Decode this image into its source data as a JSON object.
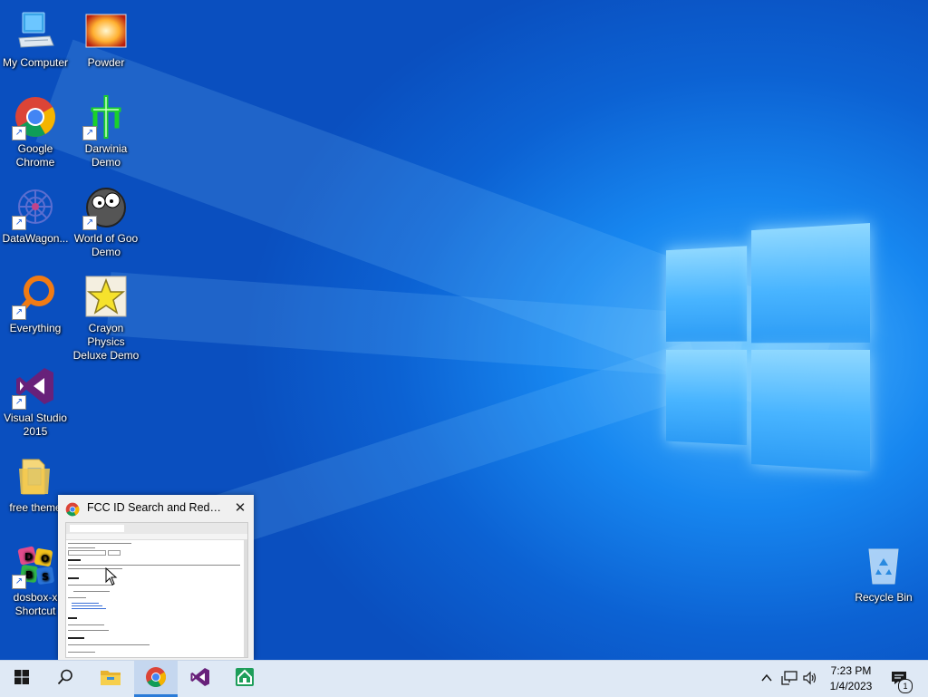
{
  "desktop_icons": [
    {
      "label": "My Computer",
      "icon": "computer-icon"
    },
    {
      "label": "Powder",
      "icon": "powder-icon"
    },
    {
      "label": "Google Chrome",
      "icon": "chrome-icon"
    },
    {
      "label": "Darwinia Demo",
      "icon": "darwinia-icon"
    },
    {
      "label": "DataWagon...",
      "icon": "datawagon-icon"
    },
    {
      "label": "World of Goo Demo",
      "icon": "world-of-goo-icon"
    },
    {
      "label": "Everything",
      "icon": "everything-search-icon"
    },
    {
      "label": "Crayon Physics Deluxe Demo",
      "icon": "crayon-physics-icon"
    },
    {
      "label": "Visual Studio 2015",
      "icon": "visual-studio-icon"
    },
    {
      "label": "free theme",
      "icon": "folder-icon"
    },
    {
      "label": "dosbox-x Shortcut",
      "icon": "dosbox-icon"
    },
    {
      "label": "Recycle Bin",
      "icon": "recycle-bin-icon"
    }
  ],
  "preview": {
    "title": "FCC ID Search and Redire...",
    "close": "✕"
  },
  "taskbar": {
    "items": [
      "start-icon",
      "search-icon",
      "file-explorer-icon",
      "chrome-icon",
      "visual-studio-icon",
      "home-app-icon"
    ]
  },
  "tray": {
    "time": "7:23 PM",
    "date": "1/4/2023",
    "notification_count": "1"
  },
  "colors": {
    "accent": "#2a7bd8",
    "taskbar": "#dfe9f5",
    "wallpaper": "#0c62d3"
  }
}
